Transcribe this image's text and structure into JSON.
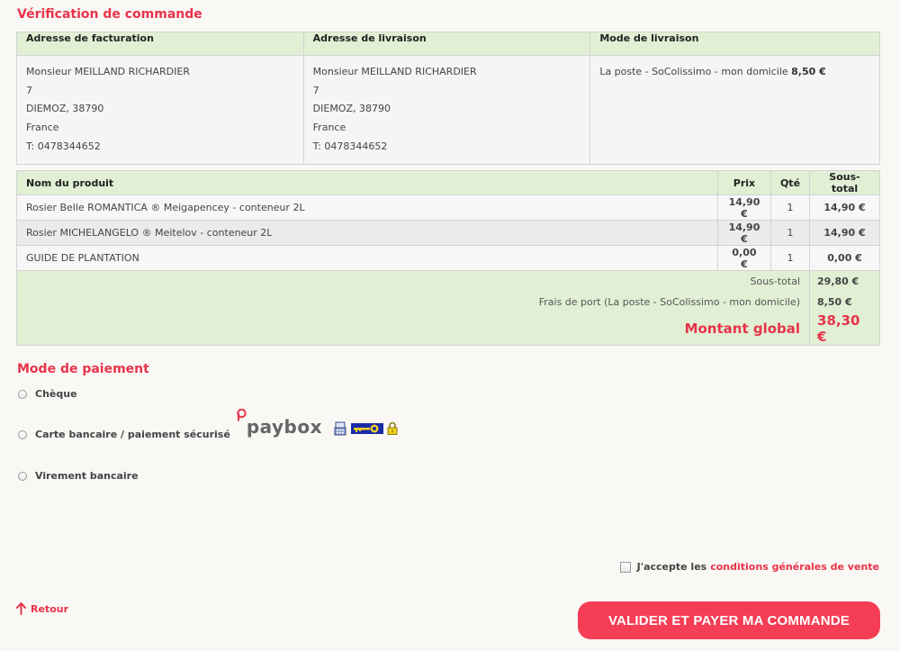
{
  "order_check": {
    "title": "Vérification de commande",
    "billing": {
      "header": "Adresse de facturation",
      "name": "Monsieur MEILLAND RICHARDIER",
      "street": "7",
      "city": "DIEMOZ, 38790",
      "country": "France",
      "phone": "T: 0478344652"
    },
    "shipping": {
      "header": "Adresse de livraison",
      "name": "Monsieur MEILLAND RICHARDIER",
      "street": "7",
      "city": "DIEMOZ, 38790",
      "country": "France",
      "phone": "T: 0478344652"
    },
    "delivery": {
      "header": "Mode de livraison",
      "method": "La poste - SoColissimo - mon domicile",
      "price": "8,50 €"
    }
  },
  "products": {
    "headers": {
      "name": "Nom du produit",
      "price": "Prix",
      "qty": "Qté",
      "subtotal": "Sous-total"
    },
    "rows": [
      {
        "name": "Rosier Belle ROMANTICA ® Meigapencey - conteneur 2L",
        "price": "14,90 €",
        "qty": "1",
        "subtotal": "14,90 €"
      },
      {
        "name": "Rosier MICHELANGELO ® Meitelov - conteneur 2L",
        "price": "14,90 €",
        "qty": "1",
        "subtotal": "14,90 €"
      },
      {
        "name": "GUIDE DE PLANTATION",
        "price": "0,00 €",
        "qty": "1",
        "subtotal": "0,00 €"
      }
    ],
    "subtotal_label": "Sous-total",
    "subtotal_value": "29,80 €",
    "shipping_label": "Frais de port (La poste - SoColissimo - mon domicile)",
    "shipping_value": "8,50 €",
    "total_label": "Montant global",
    "total_value": "38,30 €"
  },
  "payment": {
    "title": "Mode de paiement",
    "options": [
      {
        "label": "Chèque"
      },
      {
        "label": "Carte bancaire / paiement sécurisé"
      },
      {
        "label": "Virement bancaire"
      }
    ],
    "paybox_logo": "paybox"
  },
  "terms": {
    "prefix": "J'accepte les",
    "link": "conditions générales de vente"
  },
  "back_label": "Retour",
  "submit_label": "VALIDER ET PAYER MA COMMANDE",
  "colors": {
    "accent": "#e8334a",
    "header_green": "#e1efd4",
    "button": "#f53d55"
  }
}
